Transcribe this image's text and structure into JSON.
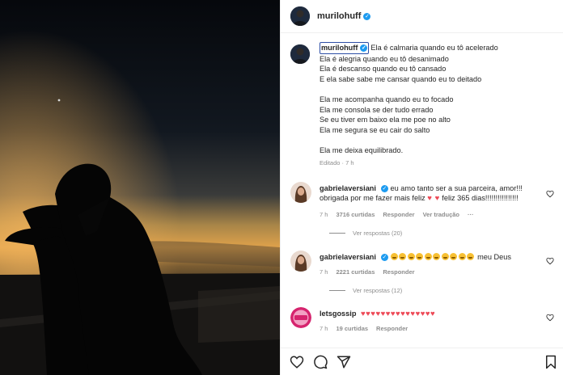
{
  "post": {
    "username": "murilohuff",
    "caption_lines": [
      "Ela é calmaria quando eu tô acelerado",
      "Ela é alegria quando eu tô desanimado",
      "Ela é descanso quando eu tô cansado",
      "E ela sabe sabe me cansar quando eu to deitado",
      "",
      "Ela me acompanha quando eu to focado",
      "Ela me consola se der tudo errado",
      "Se eu tiver em baixo ela me poe no alto",
      "Ela me segura se eu cair do salto",
      "",
      "Ela me deixa equilibrado."
    ],
    "edited_label": "Editado · 7 h"
  },
  "comments": [
    {
      "username": "gabrielaversiani",
      "text_line1": "eu amo tanto ser a sua parceira, amor!!!",
      "text_line2_a": "obrigada por me fazer mais feliz",
      "text_line2_b": "feliz 365 dias!!!!!!!!!!!!!!!!",
      "time": "7 h",
      "likes": "3716 curtidas",
      "reply_label": "Responder",
      "translate_label": "Ver tradução",
      "more": "···",
      "view_replies": "Ver respostas (20)"
    },
    {
      "username": "gabrielaversiani",
      "text_tail": "meu Deus",
      "emoji_count": 10,
      "time": "7 h",
      "likes": "2221 curtidas",
      "reply_label": "Responder",
      "view_replies": "Ver respostas (12)"
    },
    {
      "username": "letsgossip",
      "hearts": "♥♥♥♥♥♥♥♥♥♥♥♥♥♥♥",
      "time": "7 h",
      "likes": "19 curtidas",
      "reply_label": "Responder"
    }
  ],
  "icons": {
    "like": "heart-icon",
    "comment": "comment-icon",
    "share": "share-icon",
    "save": "bookmark-icon"
  },
  "colors": {
    "heart_red": "#ed4956",
    "verified_blue": "#1d9bf0",
    "secondary_text": "#8e8e8e",
    "letsgossip_brand": "#d6246e"
  }
}
